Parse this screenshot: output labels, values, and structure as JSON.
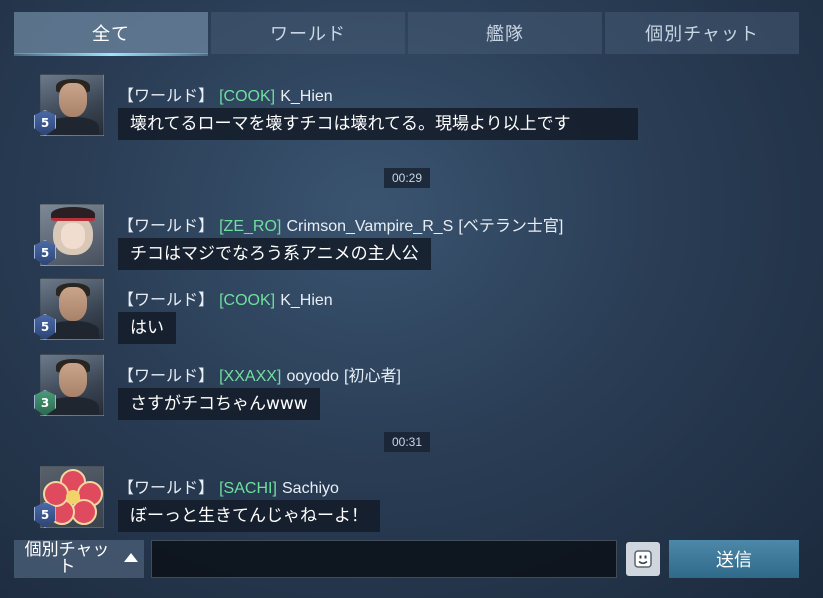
{
  "tabs": [
    {
      "label": "全て",
      "active": true
    },
    {
      "label": "ワールド",
      "active": false
    },
    {
      "label": "艦隊",
      "active": false
    },
    {
      "label": "個別チャット",
      "active": false
    }
  ],
  "messages": [
    {
      "channel": "【ワールド】",
      "tag": "[COOK]",
      "name": "K_Hien",
      "title": "",
      "text": "壊れてるローマを壊すチコは壊れてる。現場より以上です",
      "level": "5",
      "avatar_icon": "commander-man-avatar-icon"
    },
    {
      "channel": "【ワールド】",
      "tag": "[ZE_RO]",
      "name": "Crimson_Vampire_R_S",
      "title": "[ベテラン士官]",
      "text": "チコはマジでなろう系アニメの主人公",
      "level": "5",
      "avatar_icon": "officer-girl-avatar-icon"
    },
    {
      "channel": "【ワールド】",
      "tag": "[COOK]",
      "name": "K_Hien",
      "title": "",
      "text": "はい",
      "level": "5",
      "avatar_icon": "commander-man-avatar-icon"
    },
    {
      "channel": "【ワールド】",
      "tag": "[XXAXX]",
      "name": "ooyodo",
      "title": "[初心者]",
      "text": "さすがチコちゃんwww",
      "level": "3",
      "avatar_icon": "commander-man-avatar-icon"
    },
    {
      "channel": "【ワールド】",
      "tag": "[SACHI]",
      "name": "Sachiyo",
      "title": "",
      "text": "ぼーっと生きてんじゃねーよ！",
      "level": "5",
      "avatar_icon": "flower-emblem-avatar-icon"
    }
  ],
  "timestamps": [
    "00:29",
    "00:31"
  ],
  "bottom": {
    "channel_label": "個別チャット",
    "input_placeholder": "",
    "send_label": "送信"
  },
  "colors": {
    "tag": "#6fdfa0",
    "bubble": "#121a26",
    "send": "#3a7898",
    "tab_accent": "#9ee4ff"
  }
}
